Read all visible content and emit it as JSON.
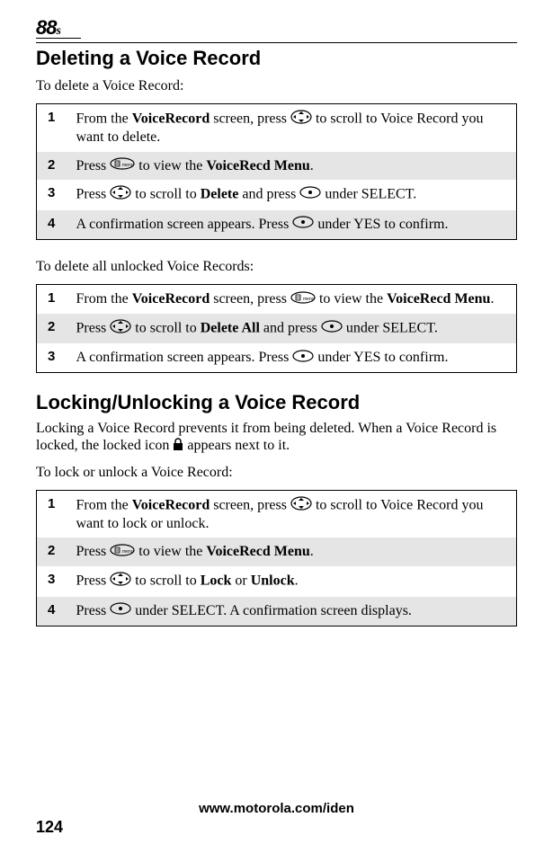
{
  "header": {
    "logo": "88",
    "logo_suffix": "s"
  },
  "section1": {
    "title": "Deleting a Voice Record",
    "intro": "To delete a Voice Record:",
    "steps": [
      {
        "num": "1",
        "pre": "From the ",
        "bold1": "VoiceRecord",
        "mid1": " screen, press ",
        "icon1": "nav-scroll",
        "mid2": " to scroll to Voice Record you want to delete."
      },
      {
        "num": "2",
        "pre": "Press ",
        "icon1": "menu-key",
        "mid1": " to view the ",
        "bold1": "VoiceRecd Menu",
        "mid2": "."
      },
      {
        "num": "3",
        "pre": "Press ",
        "icon1": "nav-scroll",
        "mid1": " to scroll to ",
        "bold1": "Delete",
        "mid2": " and press ",
        "icon2": "softkey",
        "mid3": " under SELECT."
      },
      {
        "num": "4",
        "pre": "A confirmation screen appears. Press ",
        "icon1": "softkey",
        "mid1": " under YES to confirm."
      }
    ],
    "intro2": "To delete all unlocked Voice Records:",
    "steps2": [
      {
        "num": "1",
        "pre": "From the ",
        "bold1": "VoiceRecord",
        "mid1": " screen, press ",
        "icon1": "menu-key",
        "mid2": " to view the ",
        "bold2": "VoiceRecd Menu",
        "mid3": "."
      },
      {
        "num": "2",
        "pre": "Press ",
        "icon1": "nav-scroll",
        "mid1": " to scroll to ",
        "bold1": "Delete All",
        "mid2": " and press ",
        "icon2": "softkey",
        "mid3": " under SELECT."
      },
      {
        "num": "3",
        "pre": "A confirmation screen appears. Press ",
        "icon1": "softkey",
        "mid1": " under YES to confirm."
      }
    ]
  },
  "section2": {
    "title": "Locking/Unlocking a Voice Record",
    "intro_pre": "Locking a Voice Record prevents it from being deleted. When a Voice Record is locked, the locked icon ",
    "intro_post": " appears next to it.",
    "intro2": "To lock or unlock a Voice Record:",
    "steps": [
      {
        "num": "1",
        "pre": "From the ",
        "bold1": "VoiceRecord",
        "mid1": " screen, press ",
        "icon1": "nav-scroll",
        "mid2": " to scroll to Voice Record you want to lock or unlock."
      },
      {
        "num": "2",
        "pre": "Press ",
        "icon1": "menu-key",
        "mid1": " to view the ",
        "bold1": "VoiceRecd Menu",
        "mid2": "."
      },
      {
        "num": "3",
        "pre": "Press ",
        "icon1": "nav-scroll",
        "mid1": " to scroll to ",
        "bold1": "Lock",
        "mid2": " or ",
        "bold2": "Unlock",
        "mid3": "."
      },
      {
        "num": "4",
        "pre": "Press ",
        "icon1": "softkey",
        "mid1": " under SELECT. A confirmation screen displays."
      }
    ]
  },
  "footer": {
    "url": "www.motorola.com/iden",
    "pagenum": "124"
  }
}
